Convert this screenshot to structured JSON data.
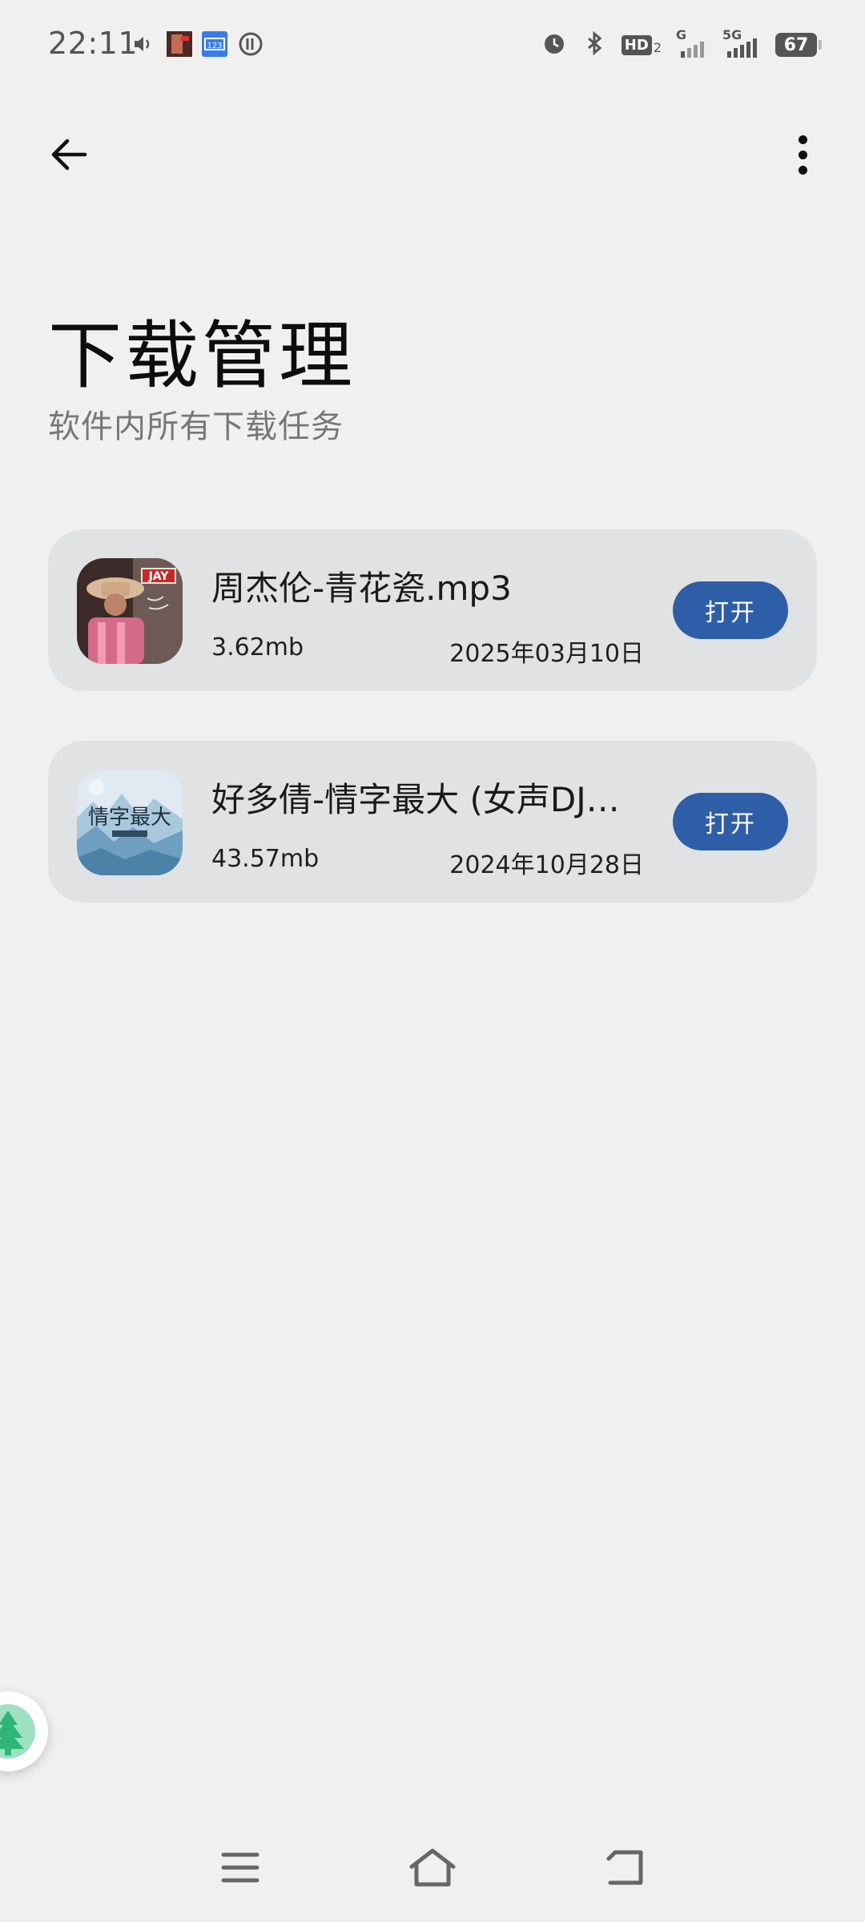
{
  "status_bar": {
    "time": "22:11",
    "left_icons": [
      "volume-icon",
      "music-app-icon",
      "keyboard-123-icon",
      "sync-icon"
    ],
    "right_icons": [
      "alarm-icon",
      "bluetooth-icon",
      "hd-icon",
      "signal-g-icon",
      "signal-5g-icon"
    ],
    "hd_label": "HD",
    "hd_sub": "2",
    "signal_g_label": "G",
    "signal_5g_label": "5G",
    "battery": "67"
  },
  "top_bar": {
    "back_icon": "arrow-left-icon",
    "more_icon": "more-vertical-icon"
  },
  "header": {
    "title": "下载管理",
    "subtitle": "软件内所有下载任务"
  },
  "downloads": [
    {
      "name": "周杰伦-青花瓷.mp3",
      "size": "3.62mb",
      "date": "2025年03月10日",
      "button": "打开",
      "thumb_badge": "JAY"
    },
    {
      "name": "好多倩-情字最大 (女声DJ…",
      "size": "43.57mb",
      "date": "2024年10月28日",
      "button": "打开",
      "thumb_text": "情字最大"
    }
  ],
  "colors": {
    "background": "#f0f0f0",
    "card": "#e1e2e4",
    "accent": "#2f5ea8"
  },
  "nav": {
    "icons": [
      "menu-icon",
      "home-icon",
      "back-icon"
    ]
  }
}
